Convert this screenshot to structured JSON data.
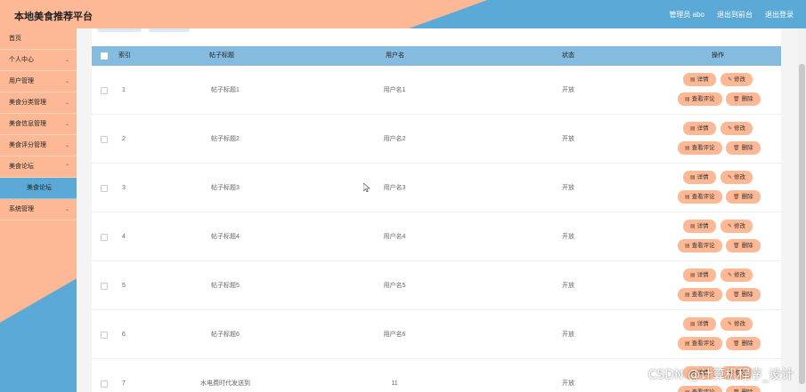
{
  "header": {
    "title": "本地美食推荐平台",
    "nav": [
      "管理员 abo",
      "退出到前台",
      "退出登录"
    ]
  },
  "sidebar": {
    "items": [
      {
        "label": "首页",
        "chevron": false
      },
      {
        "label": "个人中心",
        "chevron": true
      },
      {
        "label": "用户管理",
        "chevron": true
      },
      {
        "label": "美食分类管理",
        "chevron": true
      },
      {
        "label": "美食信息管理",
        "chevron": true
      },
      {
        "label": "美食评分管理",
        "chevron": true
      },
      {
        "label": "美食论坛",
        "chevron": true
      },
      {
        "label": "美食论坛",
        "chevron": false,
        "sub": true
      },
      {
        "label": "系统管理",
        "chevron": true
      }
    ]
  },
  "table": {
    "columns": [
      "索引",
      "帖子标题",
      "用户名",
      "状态",
      "操作"
    ],
    "rows": [
      {
        "index": "1",
        "title": "帖子标题1",
        "user": "用户名1",
        "status": "开放"
      },
      {
        "index": "2",
        "title": "帖子标题2",
        "user": "用户名2",
        "status": "开放"
      },
      {
        "index": "3",
        "title": "帖子标题3",
        "user": "用户名3",
        "status": "开放"
      },
      {
        "index": "4",
        "title": "帖子标题4",
        "user": "用户名4",
        "status": "开放"
      },
      {
        "index": "5",
        "title": "帖子标题5",
        "user": "用户名5",
        "status": "开放"
      },
      {
        "index": "6",
        "title": "帖子标题6",
        "user": "用户名6",
        "status": "开放"
      },
      {
        "index": "7",
        "title": "水电费时代发送到",
        "user": "11",
        "status": "开放"
      }
    ],
    "actions": {
      "detail": "详情",
      "edit": "修改",
      "comments": "查看评论",
      "delete": "删除"
    }
  },
  "watermark": "CSDN @计算机程序_设计",
  "colors": {
    "accent_peach": "#fdb996",
    "accent_blue": "#5aa9d6",
    "table_header": "#86bbe0"
  }
}
